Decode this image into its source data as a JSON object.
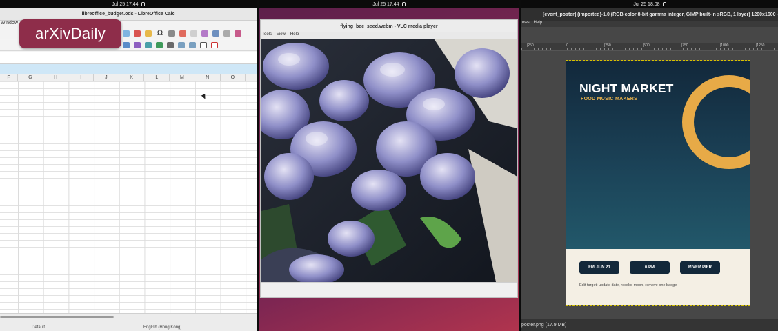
{
  "overlay_badge": "arXivDaily",
  "panel_calc": {
    "clock": "Jul 25  17:44",
    "title": "libreoffice_budget.ods - LibreOffice Calc",
    "menu_fragment": "Window",
    "columns": [
      "F",
      "G",
      "H",
      "I",
      "J",
      "K",
      "L",
      "M",
      "N",
      "O"
    ],
    "status_style": "Default",
    "status_language": "English (Hong Kong)",
    "omega_glyph": "Ω"
  },
  "panel_vlc": {
    "clock": "Jul 25  17:44",
    "title": "flying_bee_seed.webm - VLC media player",
    "menu": [
      "Tools",
      "View",
      "Help"
    ]
  },
  "panel_gimp": {
    "clock": "Jul 25  18:08",
    "title": "[event_poster] (imported)-1.0 (RGB color 8-bit gamma integer, GIMP built-in sRGB, 1 layer) 1200x1600 – GIMP",
    "menu": [
      "ows",
      "Help"
    ],
    "ruler_labels": [
      "|250",
      "|0",
      "|250",
      "|500",
      "|750",
      "|1000",
      "|1250"
    ],
    "status": "poster.png (17.9 MB)",
    "poster": {
      "title": "NIGHT MARKET",
      "subtitle": "FOOD  MUSIC  MAKERS",
      "pills": [
        "FRI JUN 21",
        "6 PM",
        "RIVER PIER"
      ],
      "note": "Edit target: update date, recolor moon, remove one badge",
      "colors": {
        "sky": "#1b4257",
        "moon": "#e7aa47",
        "paper": "#f4efe4",
        "pill": "#13283a"
      }
    }
  }
}
